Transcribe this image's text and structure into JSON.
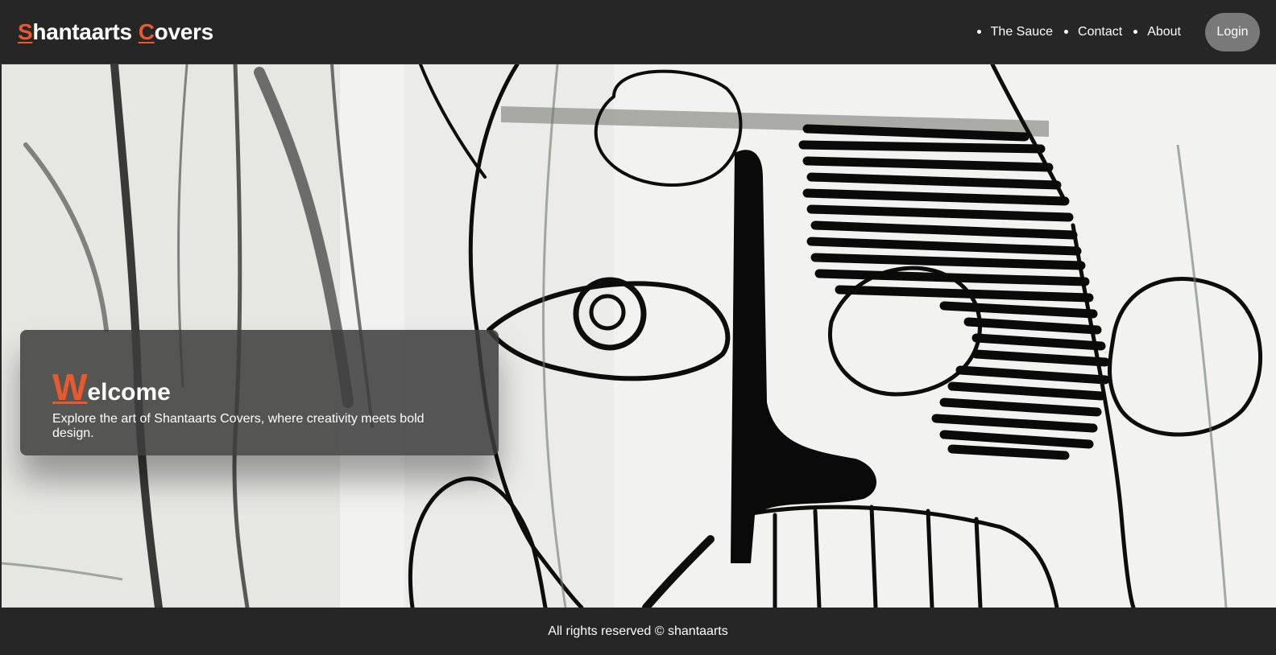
{
  "header": {
    "logo_first_initial": "S",
    "logo_first_rest": "hantaarts",
    "logo_second_initial": "C",
    "logo_second_rest": "overs",
    "nav": [
      {
        "label": "The Sauce"
      },
      {
        "label": "Contact"
      },
      {
        "label": "About"
      }
    ],
    "login_label": "Login"
  },
  "hero": {
    "image_icon": "sketch-face-artwork",
    "welcome_initial": "W",
    "welcome_rest": "elcome",
    "subtitle": "Explore the art of Shantaarts Covers, where creativity meets bold design."
  },
  "footer": {
    "text": "All rights reserved © shantaarts"
  },
  "colors": {
    "accent": "#e9592d",
    "bar": "#272627",
    "login_button": "#7a797a"
  }
}
